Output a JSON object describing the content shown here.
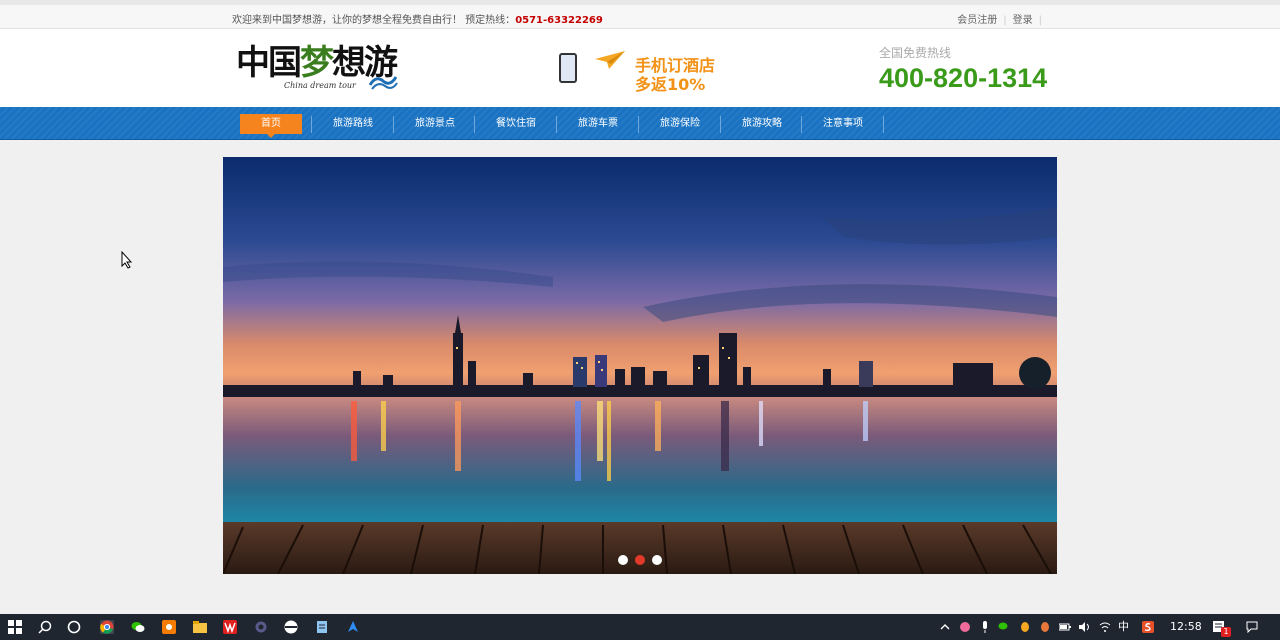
{
  "topbar": {
    "welcome": "欢迎来到中国梦想游，让你的梦想全程免费自由行！ 预定热线：",
    "hotline": "0571-63322269",
    "register": "会员注册",
    "separator": "|",
    "login": "登录"
  },
  "header": {
    "logo_text_1": "中国",
    "logo_text_2": "梦",
    "logo_text_3": "想游",
    "logo_subtitle": "China dream tour",
    "promo_line1": "手机订酒店",
    "promo_line2": "多返10%",
    "hotline_label": "全国免费热线",
    "hotline_number": "400-820-1314"
  },
  "nav": {
    "items": [
      "首页",
      "旅游路线",
      "旅游景点",
      "餐饮住宿",
      "旅游车票",
      "旅游保险",
      "旅游攻略",
      "注意事项"
    ],
    "active_index": 0
  },
  "banner": {
    "slide_count": 3,
    "active_slide": 1
  },
  "taskbar": {
    "apps": [
      "windows-start-icon",
      "search-icon",
      "cortana-icon",
      "chrome-icon",
      "wechat-icon",
      "app-orange-icon",
      "file-explorer-icon",
      "wps-icon",
      "settings-icon",
      "app-round-icon",
      "notepad-icon",
      "app-blue-icon"
    ],
    "ime": "中",
    "clock": "12:58",
    "notification_badge": "1"
  },
  "colors": {
    "nav_blue": "#1a73c2",
    "active_orange": "#f5841f",
    "hotline_green": "#3a9a1a",
    "hotline_red": "#c40000",
    "promo_orange": "#f29217"
  }
}
